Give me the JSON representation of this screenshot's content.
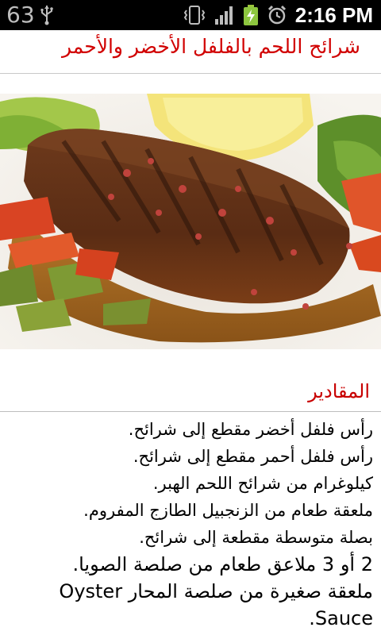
{
  "status_bar": {
    "notification_count": "63",
    "time": "2:16 PM",
    "icons": [
      "usb-icon",
      "vibrate-icon",
      "signal-icon",
      "battery-charging-icon",
      "alarm-icon"
    ]
  },
  "title": "شرائح اللحم بالفلفل الأخضر والأحمر",
  "image": {
    "subject": "steak-photo"
  },
  "section": {
    "heading": "المقادير",
    "items": [
      "رأس فلفل أخضر مقطع إلى شرائح.",
      "رأس فلفل أحمر مقطع إلى شرائح.",
      "كيلوغرام من شرائح اللحم الهبر.",
      "ملعقة طعام من الزنجبيل الطازج المفروم.",
      "بصلة متوسطة مقطعة إلى شرائح.",
      "2 أو 3 ملاعق طعام من صلصة الصويا.",
      "ملعقة صغيرة من صلصة المحار Oyster",
      "Sauce."
    ]
  },
  "colors": {
    "title": "#d10000",
    "heading": "#c80000",
    "status_bar_bg": "#000000"
  }
}
